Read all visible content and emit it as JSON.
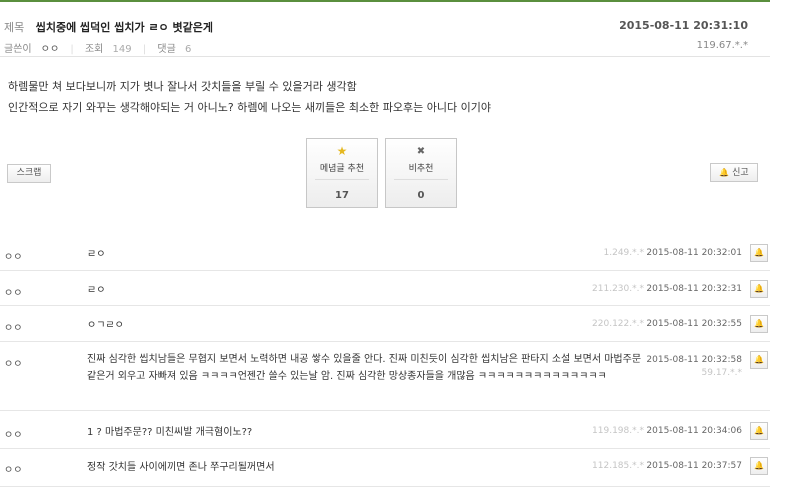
{
  "post": {
    "title_label": "제목",
    "title": "씹치중에 씹덕인 씹치가 ㄹㅇ 볏같은게",
    "date": "2015-08-11 20:31:10",
    "author_label": "글쓴이",
    "author": "ㅇㅇ",
    "views_label": "조회",
    "views": "149",
    "comments_label": "댓글",
    "comments": "6",
    "ip": "119.67.*.*",
    "body": [
      "하렘물만 쳐 보다보니까 지가 볏나 잘나서 갓치들을 부릴 수 있을거라 생각함",
      "인간적으로 자기 와꾸는 생각해야되는 거 아니노? 하렘에 나오는 새끼들은 최소한 파오후는 아니다 이기야"
    ]
  },
  "actions": {
    "scrap": "스크랩",
    "upvote_label": "메념글 추천",
    "upvote_count": "17",
    "downvote_label": "비추천",
    "downvote_count": "0",
    "report": "신고",
    "star_icon": "★",
    "x_icon": "✖",
    "bell_icon": "🔔"
  },
  "comments": [
    {
      "author": "ㅇㅇ",
      "text": "ㄹㅇ",
      "ip": "1.249.*.*",
      "date": "2015-08-11 20:32:01"
    },
    {
      "author": "ㅇㅇ",
      "text": "ㄹㅇ",
      "ip": "211.230.*.*",
      "date": "2015-08-11 20:32:31"
    },
    {
      "author": "ㅇㅇ",
      "text": "ㅇㄱㄹㅇ",
      "ip": "220.122.*.*",
      "date": "2015-08-11 20:32:55"
    },
    {
      "author": "ㅇㅇ",
      "text": "진짜 심각한 씹치남들은 무협지 보면서 노력하면 내공 쌓수 있을줄 안다. 진짜 미친듯이 심각한 씹치남은 판타지 소설 보면서 마법주문같은거 외우고 자빠져 있음 ㅋㅋㅋㅋ언젠간 쓸수 있는날 암. 진짜 심각한 망상종자들을 개많음 ㅋㅋㅋㅋㅋㅋㅋㅋㅋㅋㅋㅋㅋㅋ",
      "ip": "59.17.*.*",
      "date": "2015-08-11 20:32:58"
    },
    {
      "author": "ㅇㅇ",
      "text": "1 ? 마법주문?? 미친씨발 개극혐이노??",
      "ip": "119.198.*.*",
      "date": "2015-08-11 20:34:06"
    },
    {
      "author": "ㅇㅇ",
      "text": "정작 갓치들 사이에끼면 존나 쭈구리될꺼면서",
      "ip": "112.185.*.*",
      "date": "2015-08-11 20:37:57"
    }
  ]
}
